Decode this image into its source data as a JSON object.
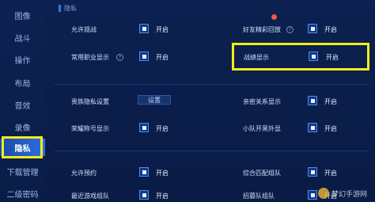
{
  "sidebar": {
    "items": [
      {
        "label": "图像"
      },
      {
        "label": "战斗"
      },
      {
        "label": "操作"
      },
      {
        "label": "布局"
      },
      {
        "label": "音效"
      },
      {
        "label": "录像"
      },
      {
        "label": "隐私",
        "active": true
      },
      {
        "label": "下载管理"
      },
      {
        "label": "二级密码"
      }
    ]
  },
  "header": {
    "title": "隐私"
  },
  "settings": {
    "allow_watch": {
      "label": "允许观战",
      "state": "开启"
    },
    "friend_highlights": {
      "label": "好友精彩回放",
      "state": "开启"
    },
    "common_role": {
      "label": "常用职业显示",
      "state": "开启"
    },
    "battle_record": {
      "label": "战绩显示",
      "state": "开启"
    },
    "noble_privacy": {
      "label": "贵族隐私设置",
      "button": "设置"
    },
    "intimate_relation": {
      "label": "亲密关系显示",
      "state": "开启"
    },
    "honor_title": {
      "label": "荣耀称号显示",
      "state": "开启"
    },
    "team_outfit": {
      "label": "小队开黑外显",
      "state": "开启"
    },
    "allow_reserve": {
      "label": "允许预约",
      "state": "开启"
    },
    "combined_match": {
      "label": "综合匹配组队",
      "state": "开启"
    },
    "recent_games": {
      "label": "最近游戏组队",
      "state": "开启"
    },
    "recruit_team": {
      "label": "招募队组队",
      "state": "开启"
    }
  },
  "watermark": {
    "text": "梦幻手游网"
  },
  "colors": {
    "highlight": "#f0ec1a",
    "accent": "#3a76e8",
    "background": "#0a1a3e"
  }
}
